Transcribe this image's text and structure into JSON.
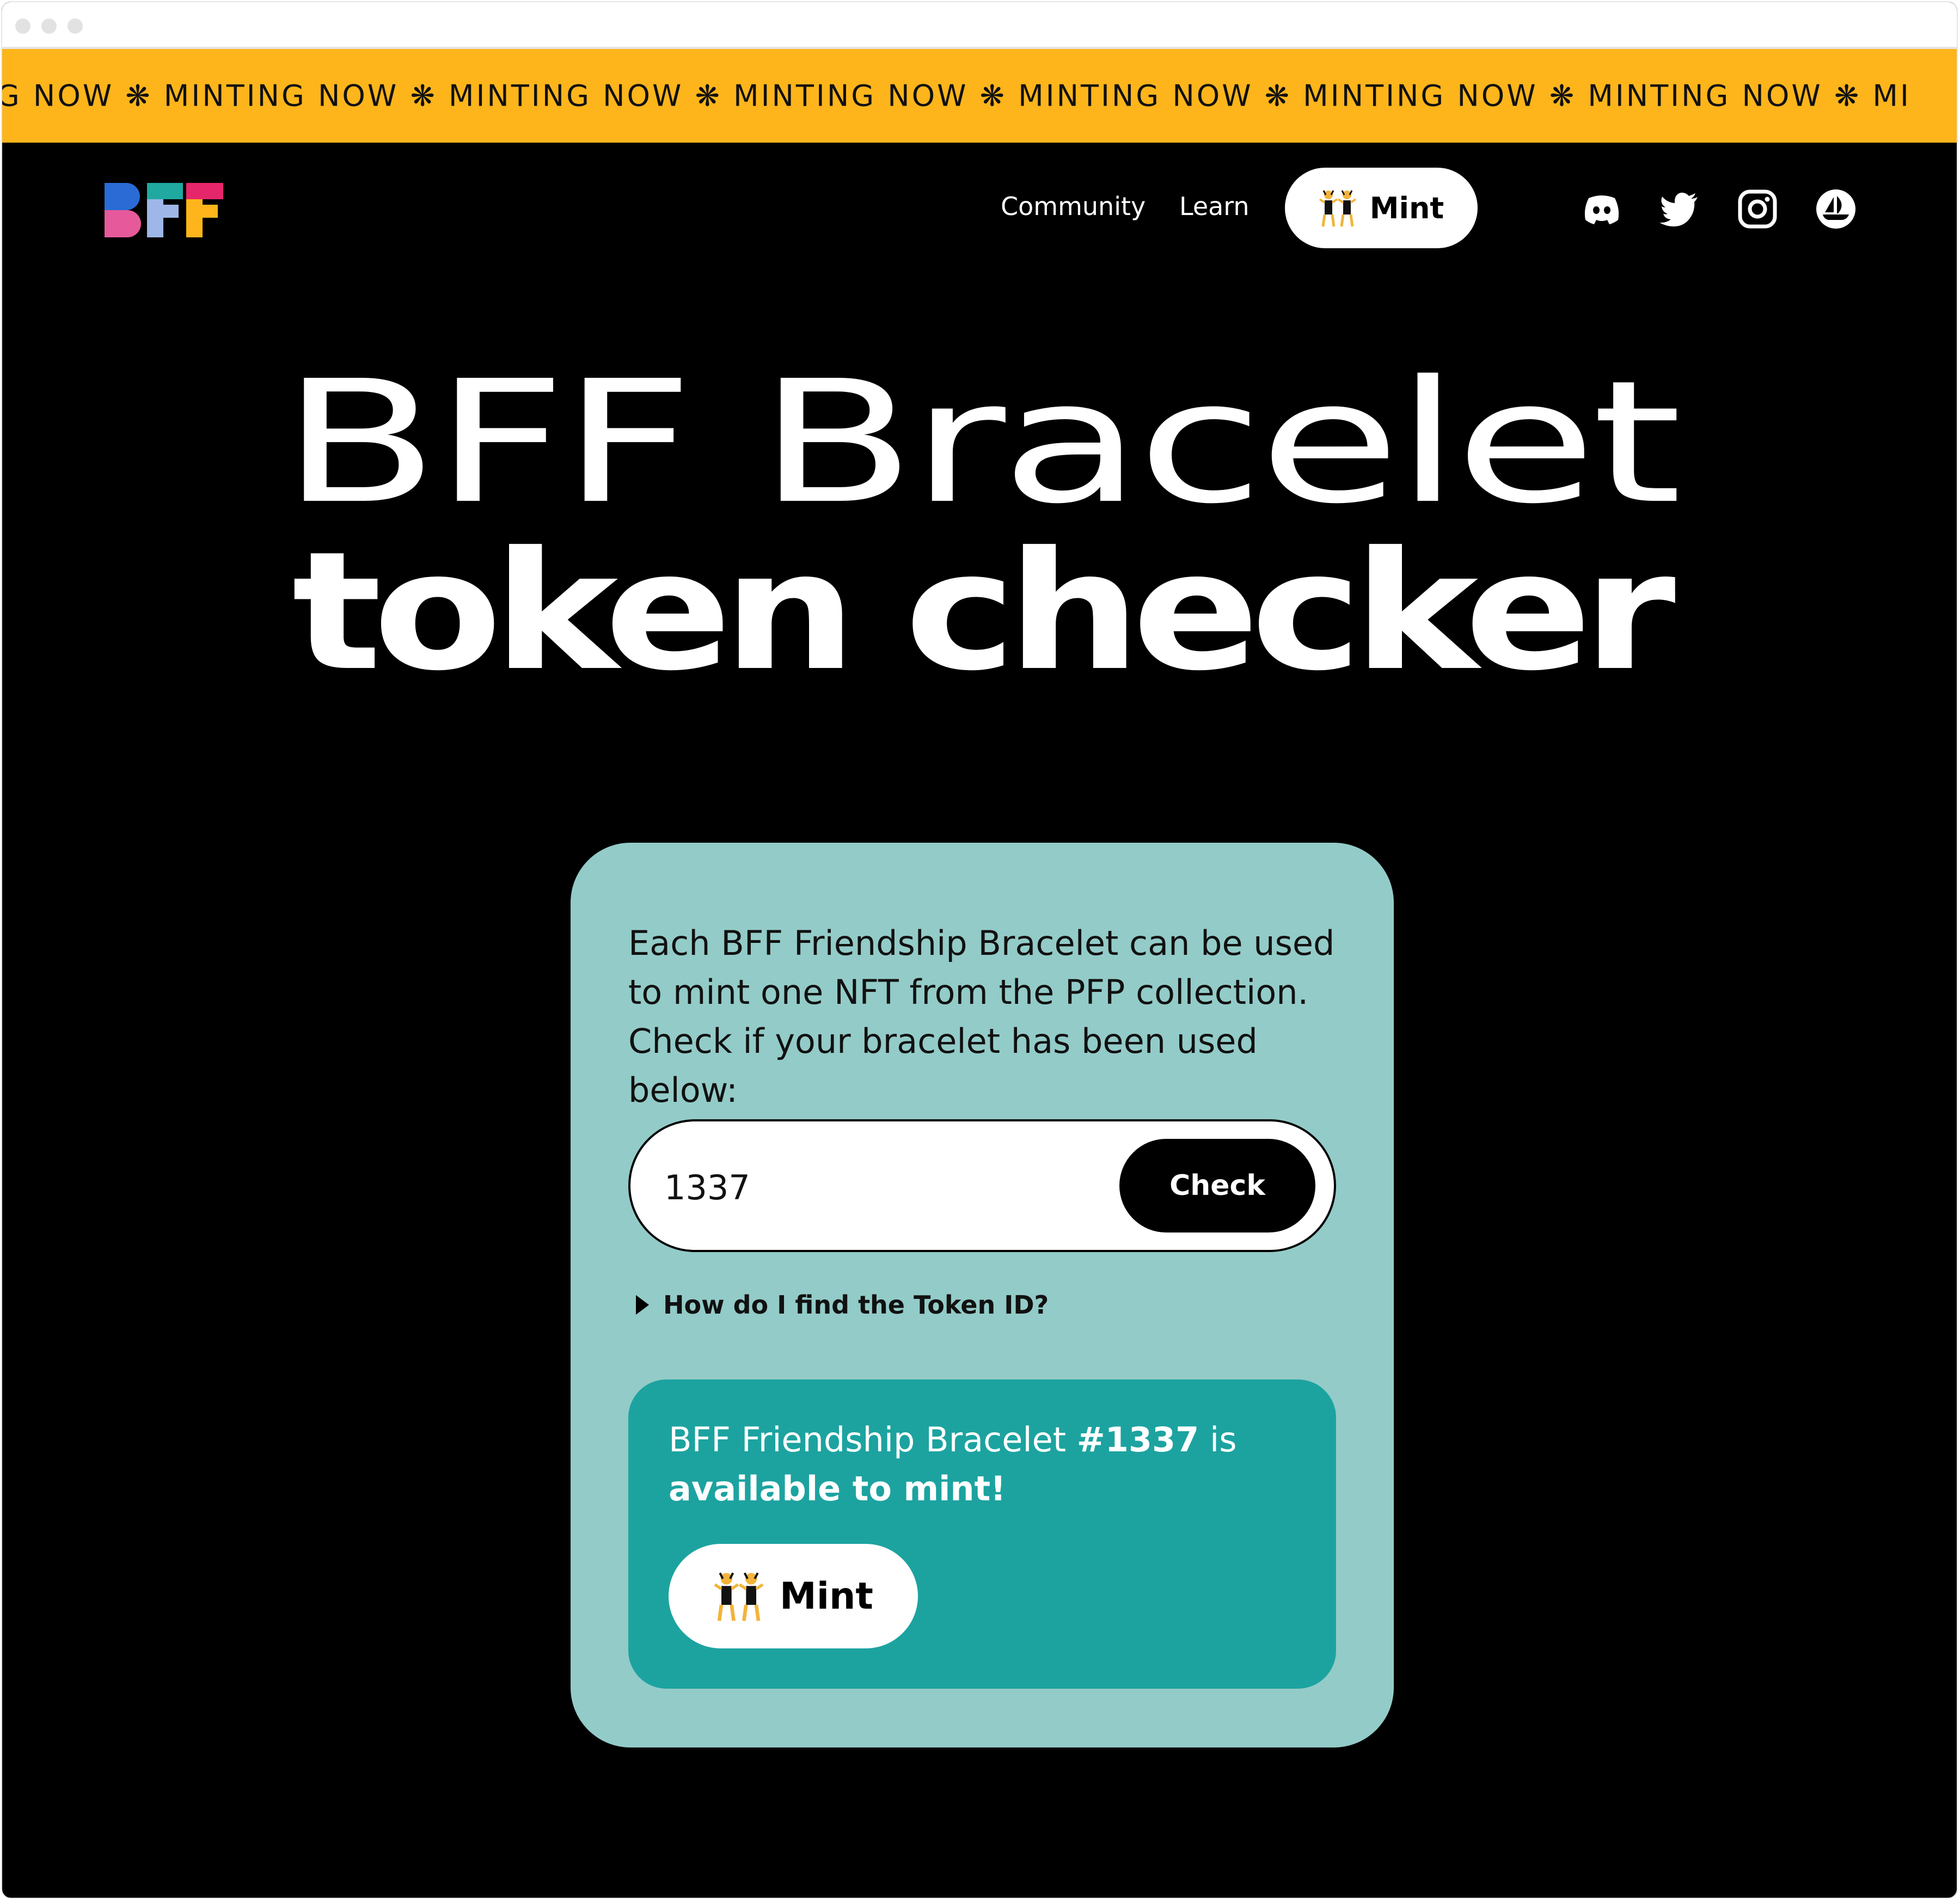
{
  "marquee": {
    "text": "IG NOW ❋ MINTING NOW ❋ MINTING NOW ❋ MINTING NOW ❋ MINTING NOW ❋ MINTING NOW ❋ MINTING NOW ❋ MI"
  },
  "nav": {
    "community": "Community",
    "learn": "Learn",
    "mint": "Mint"
  },
  "social": [
    "discord-icon",
    "twitter-icon",
    "instagram-icon",
    "opensea-icon"
  ],
  "hero": {
    "line1": "BFF Bracelet",
    "line2": "token checker"
  },
  "card": {
    "description": "Each BFF Friendship Bracelet can be used to mint one NFT from the PFP collection. Check if your bracelet has been used below:",
    "input_value": "1337",
    "check_label": "Check",
    "faq_label": "How do I find the Token ID?"
  },
  "result": {
    "prefix": "BFF Friendship Bracelet",
    "token": "#1337",
    "mid": "is",
    "status": "available to mint!",
    "mint_label": "Mint"
  },
  "colors": {
    "accent": "#fdb51b",
    "card": "#93cbc8",
    "result": "#1ca3a0"
  }
}
